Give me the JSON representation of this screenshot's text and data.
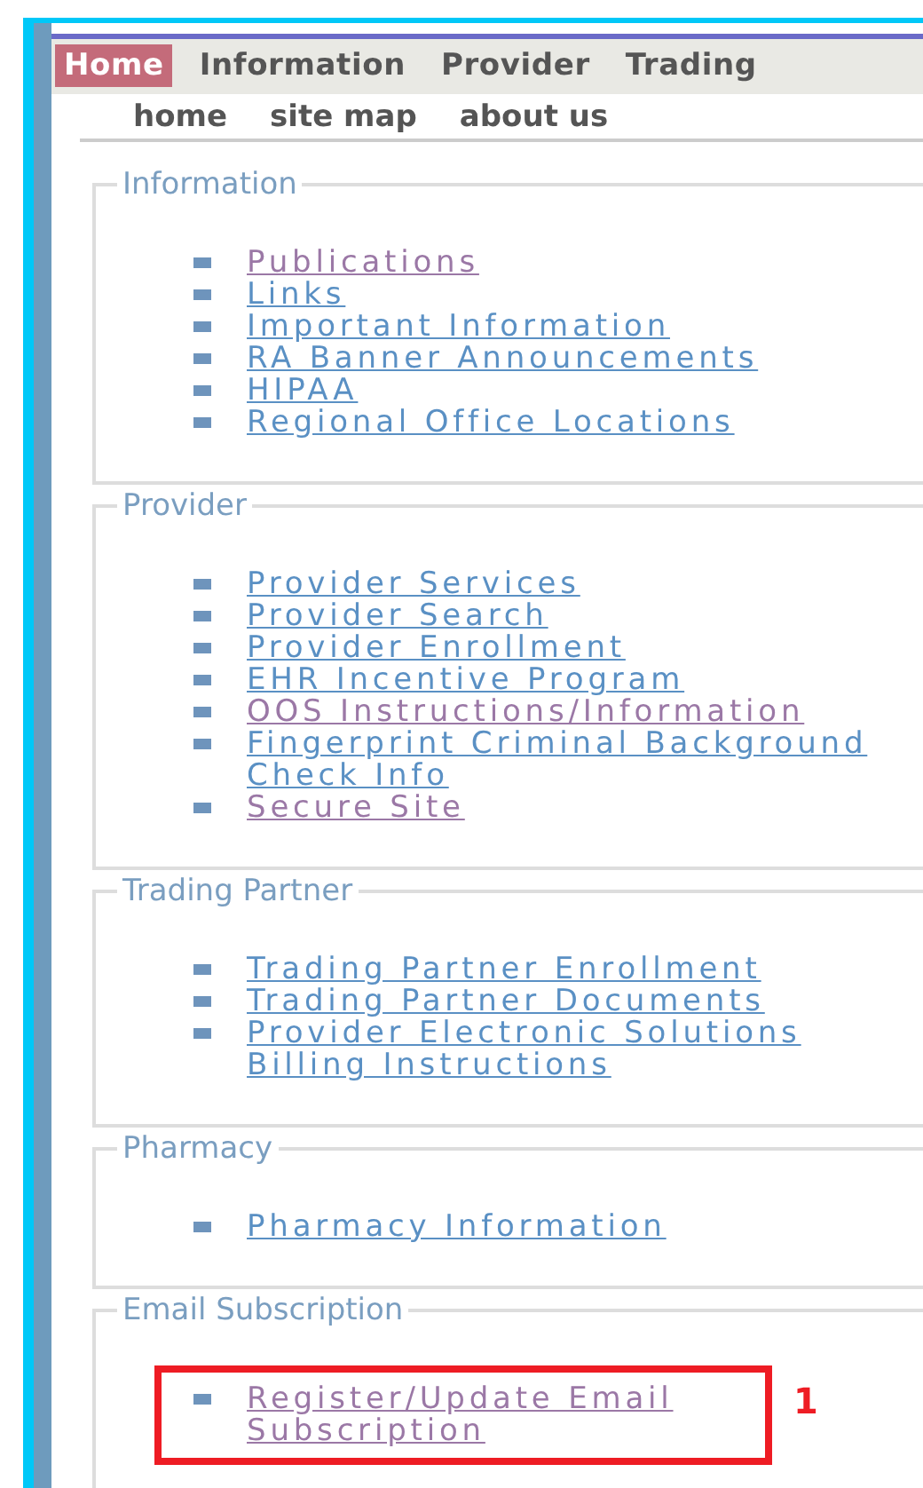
{
  "top_nav": [
    {
      "label": "Home",
      "selected": true
    },
    {
      "label": "Information",
      "selected": false
    },
    {
      "label": "Provider",
      "selected": false
    },
    {
      "label": "Trading",
      "selected": false
    }
  ],
  "sub_nav": [
    "home",
    "site map",
    "about us"
  ],
  "sections": [
    {
      "title": "Information",
      "links": [
        {
          "label": "Publications",
          "visited": true,
          "highlighted": false
        },
        {
          "label": "Links",
          "visited": false,
          "highlighted": false
        },
        {
          "label": "Important Information",
          "visited": false,
          "highlighted": false
        },
        {
          "label": "RA Banner Announcements",
          "visited": false,
          "highlighted": false
        },
        {
          "label": "HIPAA",
          "visited": false,
          "highlighted": false
        },
        {
          "label": "Regional Office Locations",
          "visited": false,
          "highlighted": false
        }
      ]
    },
    {
      "title": "Provider",
      "links": [
        {
          "label": "Provider Services",
          "visited": false,
          "highlighted": false
        },
        {
          "label": "Provider Search",
          "visited": false,
          "highlighted": false
        },
        {
          "label": "Provider Enrollment",
          "visited": false,
          "highlighted": false
        },
        {
          "label": "EHR Incentive Program",
          "visited": false,
          "highlighted": false
        },
        {
          "label": "OOS Instructions/Information",
          "visited": true,
          "highlighted": false
        },
        {
          "label": "Fingerprint Criminal Background Check Info",
          "visited": false,
          "highlighted": false
        },
        {
          "label": "Secure Site",
          "visited": true,
          "highlighted": false
        }
      ]
    },
    {
      "title": "Trading Partner",
      "links": [
        {
          "label": "Trading Partner Enrollment",
          "visited": false,
          "highlighted": false
        },
        {
          "label": "Trading Partner Documents",
          "visited": false,
          "highlighted": false
        },
        {
          "label": "Provider Electronic Solutions Billing Instructions",
          "visited": false,
          "highlighted": false
        }
      ]
    },
    {
      "title": "Pharmacy",
      "links": [
        {
          "label": "Pharmacy Information",
          "visited": false,
          "highlighted": false
        }
      ]
    },
    {
      "title": "Email Subscription",
      "links": [
        {
          "label": "Register/Update Email Subscription",
          "visited": true,
          "highlighted": true,
          "annotation": "1"
        }
      ]
    }
  ]
}
